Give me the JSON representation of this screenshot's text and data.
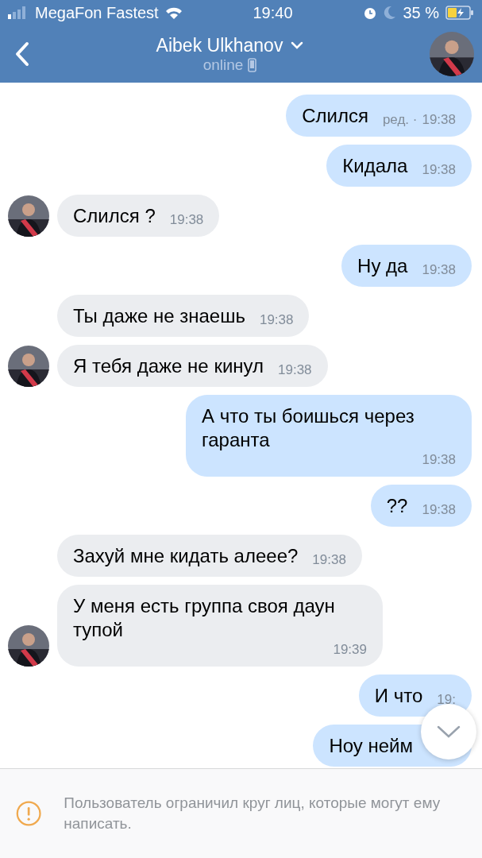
{
  "status_bar": {
    "carrier": "MegaFon Fastest",
    "time": "19:40",
    "battery": "35 %"
  },
  "header": {
    "name": "Aibek Ulkhanov",
    "status": "online"
  },
  "messages": [
    {
      "kind": "outgoing",
      "text": "Слился",
      "edited": "ред. ·",
      "time": "19:38",
      "avatar": false
    },
    {
      "kind": "outgoing",
      "text": "Кидала",
      "time": "19:38",
      "avatar": false
    },
    {
      "kind": "incoming",
      "text": "Слился ?",
      "time": "19:38",
      "avatar": true
    },
    {
      "kind": "outgoing",
      "text": "Ну да",
      "time": "19:38",
      "avatar": false
    },
    {
      "kind": "incoming",
      "text": "Ты даже не знаешь",
      "time": "19:38",
      "avatar": false
    },
    {
      "kind": "incoming",
      "text": "Я тебя даже не кинул",
      "time": "19:38",
      "avatar": true
    },
    {
      "kind": "outgoing",
      "text": "А что ты боишься через гаранта",
      "time": "19:38",
      "avatar": false
    },
    {
      "kind": "outgoing",
      "text": "??",
      "time": "19:38",
      "avatar": false
    },
    {
      "kind": "incoming",
      "text": "Захуй мне кидать алеее?",
      "time": "19:38",
      "avatar": false
    },
    {
      "kind": "incoming",
      "text": "У меня есть группа своя даун тупой",
      "time": "19:39",
      "avatar": true
    },
    {
      "kind": "outgoing",
      "text": "И что",
      "time": "19:",
      "avatar": false
    },
    {
      "kind": "outgoing",
      "text": "Ноу нейм",
      "avatar": false
    }
  ],
  "notice": "Пользователь ограничил круг лиц, которые могут ему написать."
}
